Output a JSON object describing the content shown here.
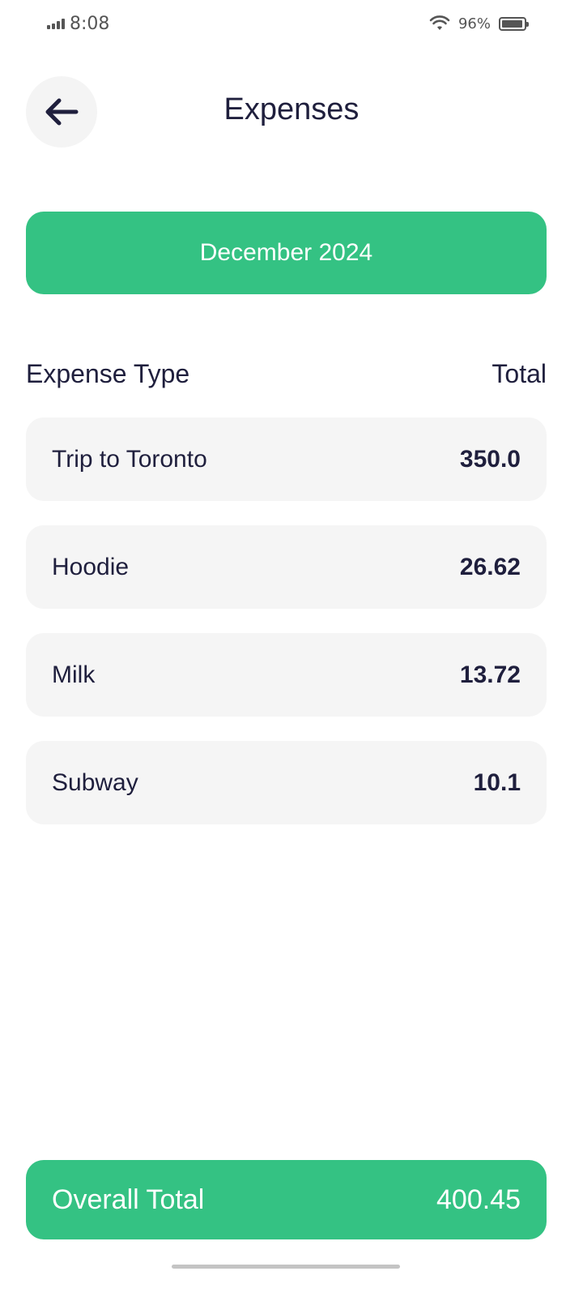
{
  "status_bar": {
    "time": "8:08",
    "battery_percent_label": "96%",
    "battery_level": 0.96,
    "icons": [
      "signal-icon",
      "wifi-icon",
      "battery-icon"
    ]
  },
  "header": {
    "title": "Expenses",
    "back_icon": "arrow-left-icon"
  },
  "month": {
    "label": "December 2024"
  },
  "columns": {
    "type_label": "Expense Type",
    "total_label": "Total"
  },
  "expenses": [
    {
      "name": "Trip to Toronto",
      "amount": "350.0"
    },
    {
      "name": "Hoodie",
      "amount": "26.62"
    },
    {
      "name": "Milk",
      "amount": "13.72"
    },
    {
      "name": "Subway",
      "amount": "10.1"
    }
  ],
  "total": {
    "label": "Overall Total",
    "value": "400.45"
  },
  "colors": {
    "accent": "#34c283",
    "text": "#1f1f3d",
    "row_background": "#f5f5f5"
  }
}
